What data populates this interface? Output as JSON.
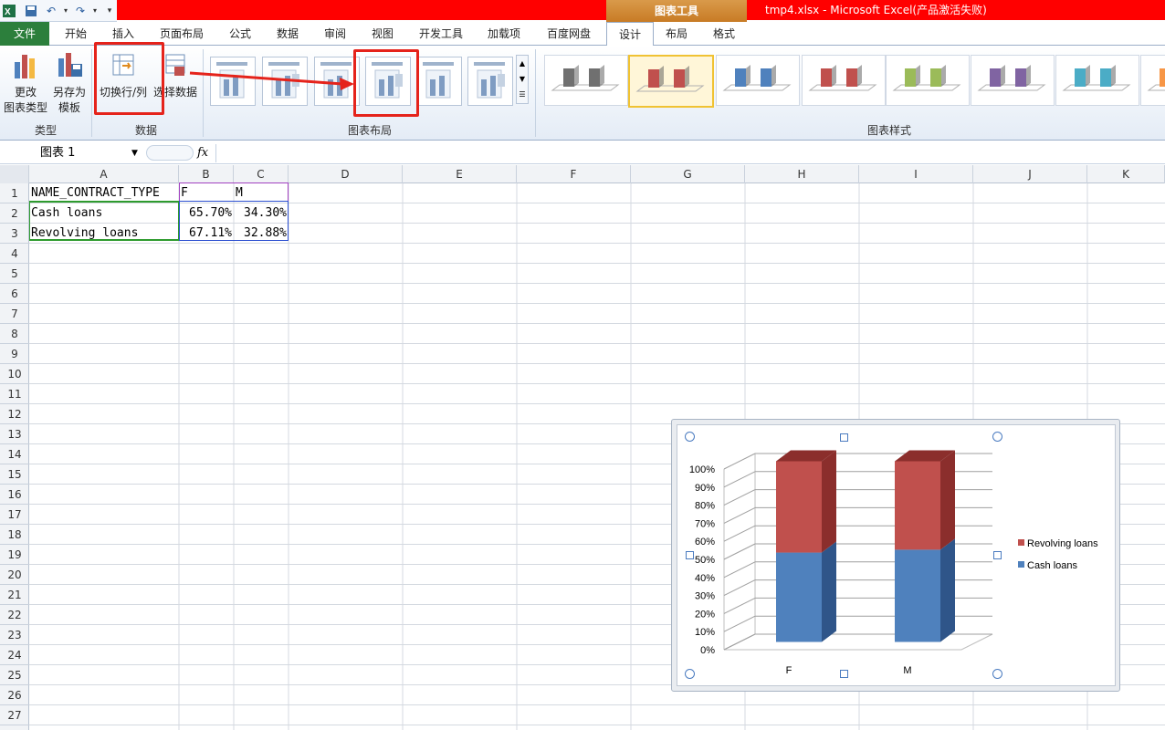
{
  "window": {
    "title": "tmp4.xlsx  -  Microsoft Excel(产品激活失败)",
    "context_tab_label": "图表工具"
  },
  "tabs": [
    "文件",
    "开始",
    "插入",
    "页面布局",
    "公式",
    "数据",
    "审阅",
    "视图",
    "开发工具",
    "加载项",
    "百度网盘",
    "设计",
    "布局",
    "格式"
  ],
  "active_tab": "设计",
  "ribbon": {
    "type_group": {
      "label": "类型",
      "change_type": "更改\n图表类型",
      "save_template": "另存为\n模板"
    },
    "data_group": {
      "label": "数据",
      "switch_row_col": "切换行/列",
      "select_data": "选择数据"
    },
    "layout_group": {
      "label": "图表布局"
    },
    "styles_group": {
      "label": "图表样式"
    },
    "style_colors": [
      "#707070",
      "#c0504d",
      "#4f81bd",
      "#c0504d",
      "#9bbb59",
      "#8064a2",
      "#4bacc6",
      "#f79646"
    ]
  },
  "formula_bar": {
    "name_box": "图表 1",
    "fx_label": "fx",
    "content": ""
  },
  "sheet": {
    "columns": [
      "A",
      "B",
      "C",
      "D",
      "E",
      "F",
      "G",
      "H",
      "I",
      "J",
      "K"
    ],
    "rows": [
      "1",
      "2",
      "3",
      "4",
      "5",
      "6",
      "7",
      "8",
      "9",
      "10",
      "11",
      "12",
      "13",
      "14",
      "15",
      "16",
      "17",
      "18",
      "19",
      "20",
      "21",
      "22",
      "23",
      "24",
      "25",
      "26",
      "27"
    ],
    "cells": {
      "A1": "NAME_CONTRACT_TYPE",
      "B1": "F",
      "C1": "M",
      "A2": "Cash loans",
      "B2": "65.70%",
      "C2": "34.30%",
      "A3": "Revolving loans",
      "B3": "67.11%",
      "C3": "32.88%"
    }
  },
  "chart_data": {
    "type": "bar",
    "stacked": "percent",
    "categories": [
      "F",
      "M"
    ],
    "series": [
      {
        "name": "Cash loans",
        "values": [
          65.7,
          34.3
        ],
        "color": "#4f81bd",
        "side_color": "#2f5589"
      },
      {
        "name": "Revolving loans",
        "values": [
          67.11,
          32.88
        ],
        "color": "#c0504d",
        "side_color": "#8b2e2c"
      }
    ],
    "y_ticks": [
      "0%",
      "10%",
      "20%",
      "30%",
      "40%",
      "50%",
      "60%",
      "70%",
      "80%",
      "90%",
      "100%"
    ],
    "ylim": [
      0,
      100
    ],
    "legend_position": "right",
    "gridlines": true,
    "three_d": true
  }
}
